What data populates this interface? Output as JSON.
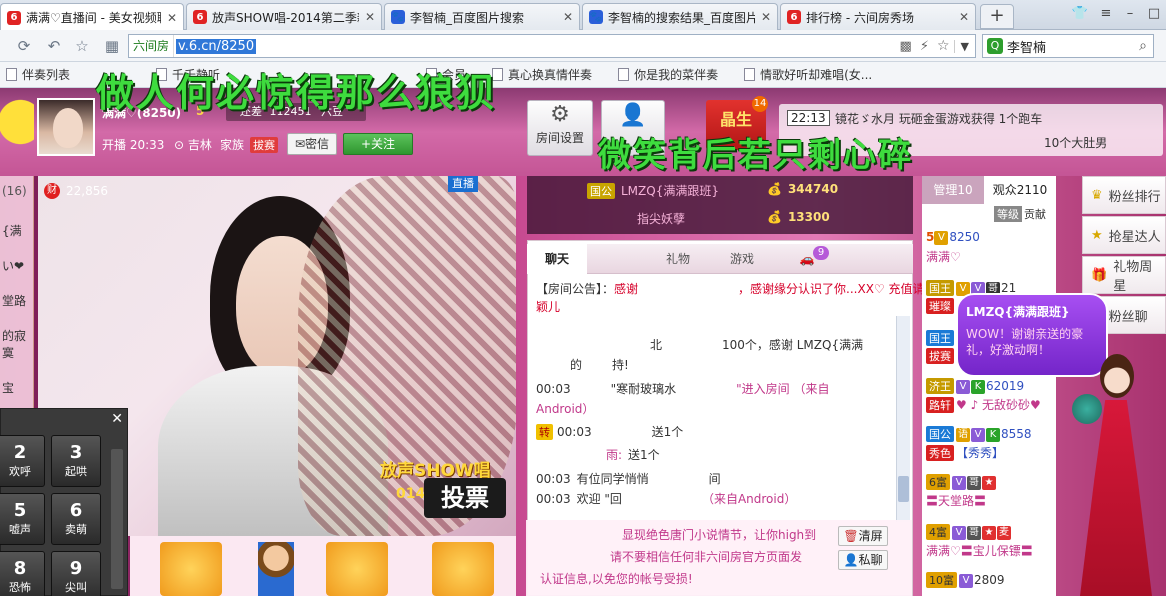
{
  "browser": {
    "tabs": [
      {
        "title": "满满♡直播间 - 美女视频聊",
        "favicon": "6",
        "favcolor": "#e02323"
      },
      {
        "title": "放声SHOW唱-2014第二季新秀",
        "favicon": "6",
        "favcolor": "#e02323"
      },
      {
        "title": "李智楠_百度图片搜索",
        "favicon": "🐾",
        "favcolor": "#2b5fd9"
      },
      {
        "title": "李智楠的搜索结果_百度图片",
        "favicon": "🐾",
        "favcolor": "#2b5fd9"
      },
      {
        "title": "排行榜 - 六间房秀场",
        "favicon": "6",
        "favcolor": "#e02323"
      }
    ],
    "new_tab": "+",
    "address": {
      "site_label": "六间房",
      "url": "v.6.cn/8250"
    },
    "search": {
      "value": "李智楠"
    },
    "bookmarks": [
      "伴奏列表",
      "千千静听",
      "会员",
      "真心换真情伴奏",
      "你是我的菜伴奏",
      "情歌好听却难唱(女..."
    ]
  },
  "overlay": {
    "line1": "做人何必惊得那么狼狈",
    "line2": "微笑背后若只剩心碎"
  },
  "host": {
    "name": "满满♡(8250)",
    "level_num": "5",
    "gap_label": "还差",
    "gap_value": "112451",
    "next_label": "六豆",
    "start_label": "开播 20:33",
    "location": "吉林",
    "family_label": "家族",
    "family_badge": "拔赛",
    "msg_label": "密信",
    "follow_label": "+关注"
  },
  "header_buttons": {
    "room_settings": "房间设置",
    "star_label": "晶生",
    "star_count": "14"
  },
  "marquee": {
    "time": "22:13",
    "line1": "镜花ゞ水月 玩砸金蛋游戏获得 1个跑车",
    "line2": "10个大肚男"
  },
  "video": {
    "wealth_value": "22,856",
    "live_label": "直播",
    "show_label": "放声SHOW唱",
    "vote_label": "投票",
    "year": "014"
  },
  "left_strip": {
    "count": "(16)",
    "items": [
      "{满",
      "い❤",
      "堂路",
      "的寂寞",
      "宝"
    ]
  },
  "keypad": [
    {
      "num": "2",
      "label": "欢呼"
    },
    {
      "num": "3",
      "label": "起哄"
    },
    {
      "num": "5",
      "label": "嘘声"
    },
    {
      "num": "6",
      "label": "卖萌"
    },
    {
      "num": "8",
      "label": "恐怖"
    },
    {
      "num": "9",
      "label": "尖叫"
    }
  ],
  "fans": [
    {
      "badge": "国公",
      "name": "LMZQ{满满跟班}",
      "value": "344740"
    },
    {
      "badge": "",
      "name": "指尖妖孽",
      "value": "13300"
    }
  ],
  "chat": {
    "tabs": [
      "聊天",
      "",
      "礼物",
      "游戏"
    ],
    "car_badge": "9",
    "lines": [
      {
        "prefix": "【房间公告】：",
        "text": "感谢",
        "text2": "，感谢缘分认识了你...XX♡ 充值请找"
      },
      {
        "prefix": "",
        "text": "颖儿",
        "text2": ""
      },
      {
        "prefix": "",
        "text": "北",
        "text2": "100个，感谢 LMZQ{满满"
      },
      {
        "prefix": "",
        "text": "的",
        "text2": "持!"
      },
      {
        "prefix": "00:03",
        "text": "\"寒耐玻璃水",
        "text2": "\"进入房间 （来自"
      },
      {
        "prefix": "",
        "text": "Android）",
        "text2": ""
      },
      {
        "prefix": "00:03",
        "text": "转",
        "text2": "送1个"
      },
      {
        "prefix": "",
        "text": "雨:",
        "text2": "送1个"
      },
      {
        "prefix": "00:03",
        "text": "有位同学悄悄",
        "text2": "间"
      },
      {
        "prefix": "00:03",
        "text": "欢迎 \"回",
        "text2": "（来自Android）"
      }
    ],
    "notice1": "显现绝色唐门小说情节，让你high到",
    "notice2": "请不要相信任何非六间房官方页面发",
    "notice3": "认证信息,以免您的帐号受损!",
    "clear_label": "清屏",
    "private_label": "私聊"
  },
  "viewers": {
    "tab_admin": "管理10",
    "tab_audience": "观众2110",
    "sub_level": "等级",
    "sub_contrib": "贡献",
    "rows": [
      {
        "rank": "5",
        "name": "8250",
        "extra": "满满♡"
      },
      {
        "rank": "",
        "name": "21",
        "extra": "璀璨"
      },
      {
        "rank": "",
        "name": "",
        "extra": "拔赛"
      },
      {
        "rank": "",
        "name": "62019",
        "extra": "♥ ♪ 无敌砂砂♥"
      },
      {
        "rank": "",
        "name": "8558",
        "extra": "【秀秀】"
      },
      {
        "rank": "6富",
        "name": "",
        "extra": "〓天堂路〓"
      },
      {
        "rank": "4富",
        "name": "",
        "extra": "满满♡〓宝儿保镖〓"
      },
      {
        "rank": "10富",
        "name": "2809",
        "extra": ""
      }
    ]
  },
  "bubble": {
    "name": "LMZQ{满满跟班}",
    "text": "WOW！谢谢亲送的豪礼，好激动啊！"
  },
  "right_menu": [
    "粉丝排行",
    "抢星达人",
    "礼物周星",
    "粉丝聊"
  ]
}
